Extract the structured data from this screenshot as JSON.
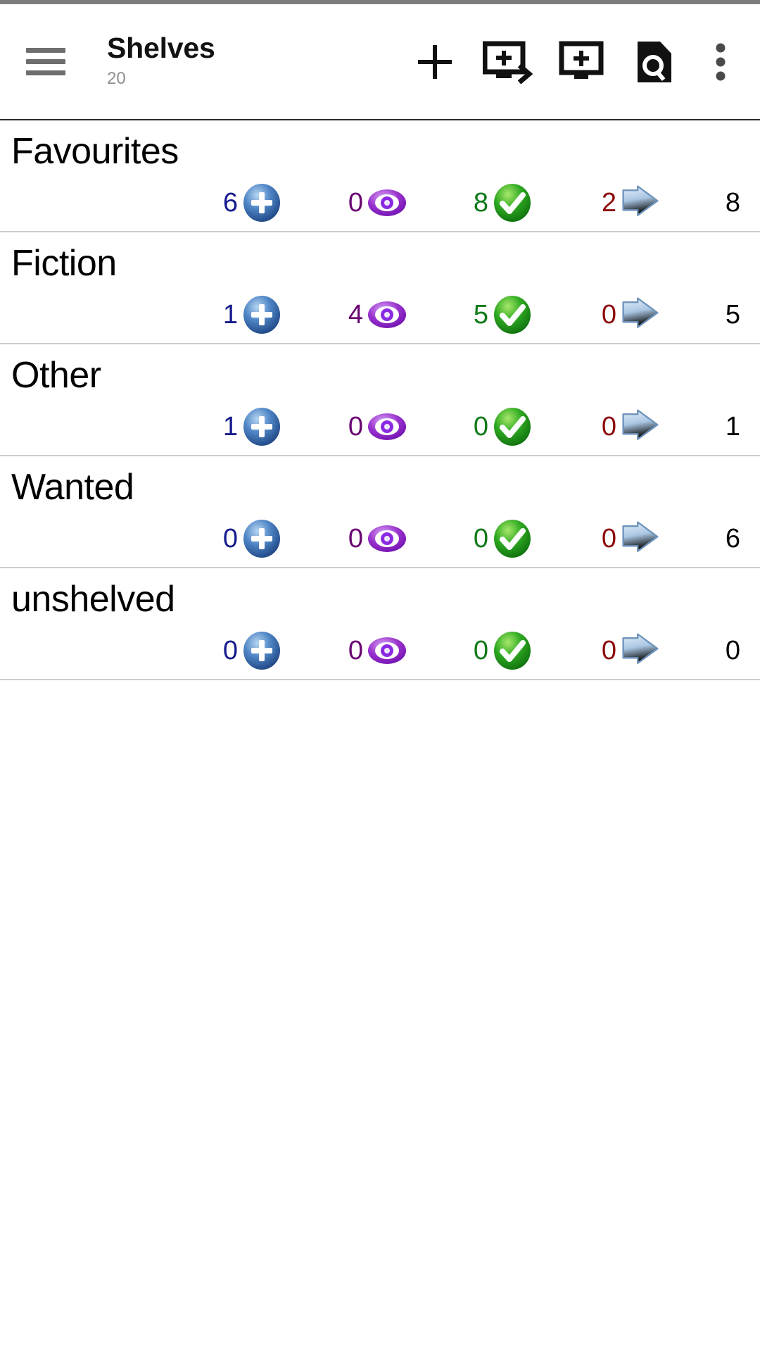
{
  "app": {
    "title": "Shelves",
    "subtitle": "20"
  },
  "toolbar": {
    "menu_icon": "hamburger-menu-icon",
    "actions": [
      {
        "name": "add-shelf-button",
        "icon": "plus-icon",
        "label": "Add"
      },
      {
        "name": "add-and-go-button",
        "icon": "monitor-plus-arrow-icon",
        "label": "Add and open"
      },
      {
        "name": "add-to-screen-button",
        "icon": "monitor-plus-icon",
        "label": "Add to screen"
      },
      {
        "name": "search-document-button",
        "icon": "document-search-icon",
        "label": "Search"
      },
      {
        "name": "overflow-menu-button",
        "icon": "three-dot-vertical-icon",
        "label": "More options"
      }
    ]
  },
  "columns": {
    "to_read": {
      "icon": "blue-plus-circle-icon",
      "color": "#151b8d"
    },
    "reading": {
      "icon": "purple-eye-icon",
      "color": "#6a0572"
    },
    "read": {
      "icon": "green-check-circle-icon",
      "color": "#0f7a18"
    },
    "lent": {
      "icon": "blue-arrow-right-icon",
      "color": "#8b0b0b"
    },
    "total": {
      "icon": "none",
      "color": "#000000"
    }
  },
  "shelves": [
    {
      "name": "Favourites",
      "to_read": "6",
      "reading": "0",
      "read": "8",
      "lent": "2",
      "total": "8"
    },
    {
      "name": "Fiction",
      "to_read": "1",
      "reading": "4",
      "read": "5",
      "lent": "0",
      "total": "5"
    },
    {
      "name": "Other",
      "to_read": "1",
      "reading": "0",
      "read": "0",
      "lent": "0",
      "total": "1"
    },
    {
      "name": "Wanted",
      "to_read": "0",
      "reading": "0",
      "read": "0",
      "lent": "0",
      "total": "6"
    },
    {
      "name": "unshelved",
      "to_read": "0",
      "reading": "0",
      "read": "0",
      "lent": "0",
      "total": "0"
    }
  ]
}
